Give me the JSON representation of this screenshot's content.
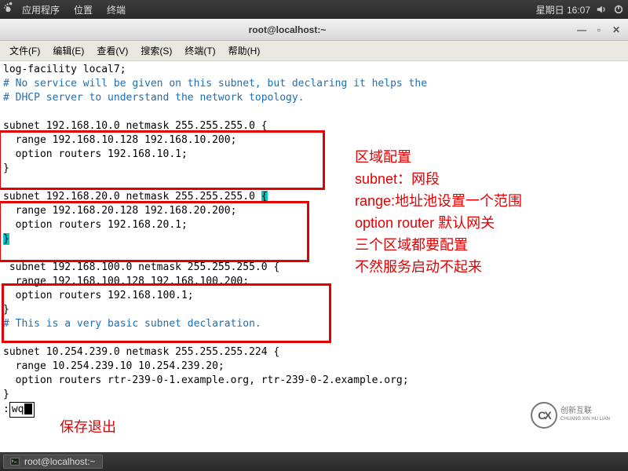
{
  "top_panel": {
    "apps": "应用程序",
    "places": "位置",
    "terminal": "终端",
    "date": "星期日 16:07"
  },
  "window": {
    "title": "root@localhost:~"
  },
  "menubar": {
    "file": "文件(F)",
    "edit": "编辑(E)",
    "view": "查看(V)",
    "search": "搜索(S)",
    "terminal": "终端(T)",
    "help": "帮助(H)"
  },
  "terminal": {
    "l1": "log-facility local7;",
    "l2": "",
    "c1": "# No service will be given on this subnet, but declaring it helps the",
    "c2": "# DHCP server to understand the network topology.",
    "s1a": "subnet 192.168.10.0 netmask 255.255.255.0 {",
    "s1b": "  range 192.168.10.128 192.168.10.200;",
    "s1c": "  option routers 192.168.10.1;",
    "s1d": "}",
    "s2a0": "subnet 192.168.20.0 netmask 255.255.255.0 ",
    "s2a1": "{",
    "s2b": "  range 192.168.20.128 192.168.20.200;",
    "s2c": "  option routers 192.168.20.1;",
    "s2d": "}",
    "s3a": " subnet 192.168.100.0 netmask 255.255.255.0 {",
    "s3b": "  range 192.168.100.128 192.168.100.200;",
    "s3c": "  option routers 192.168.100.1;",
    "s3d": "}",
    "c3": "# This is a very basic subnet declaration.",
    "s4a": "subnet 10.254.239.0 netmask 255.255.255.224 {",
    "s4b": "  range 10.254.239.10 10.254.239.20;",
    "s4c": "  option routers rtr-239-0-1.example.org, rtr-239-0-2.example.org;",
    "s4d": "}",
    "cmdprefix": ":",
    "cmd": "wq"
  },
  "annotations": {
    "r1": "区域配置",
    "r2": "subnet：网段",
    "r3": "range:地址池设置一个范围",
    "r4": "option router 默认网关",
    "r5": "三个区域都要配置",
    "r6": "不然服务启动不起来",
    "save": "保存退出"
  },
  "logo": {
    "mark": "CX",
    "line1": "创新互联",
    "line2": "CHUANG XIN HU LIAN"
  },
  "taskbar": {
    "item": "root@localhost:~"
  }
}
